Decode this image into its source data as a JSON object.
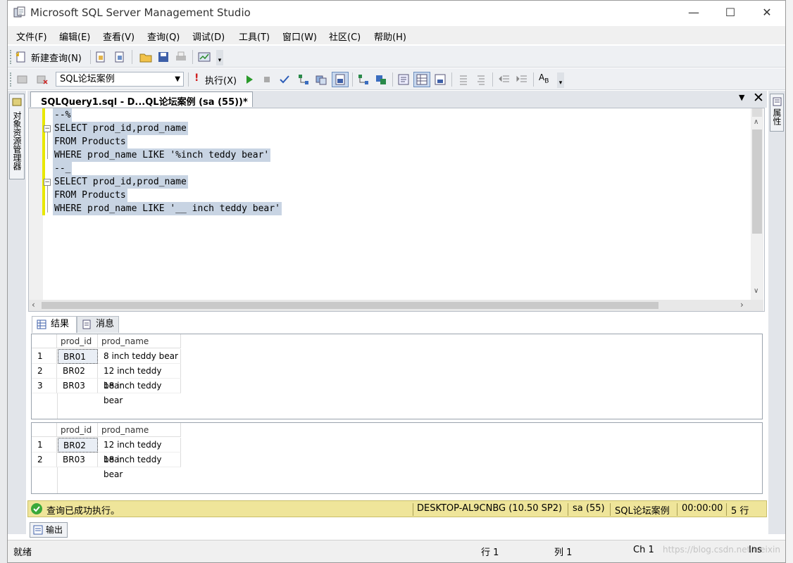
{
  "window": {
    "title": "Microsoft SQL Server Management Studio",
    "controls": [
      "—",
      "☐",
      "✕"
    ]
  },
  "menu": [
    "文件(F)",
    "编辑(E)",
    "查看(V)",
    "查询(Q)",
    "调试(D)",
    "工具(T)",
    "窗口(W)",
    "社区(C)",
    "帮助(H)"
  ],
  "toolbar1": {
    "new_query": "新建查询(N)"
  },
  "toolbar2": {
    "database": "SQL论坛案例",
    "execute": "执行(X)"
  },
  "left_panel": {
    "label": "对象资源管理器"
  },
  "right_panel": {
    "label": "属性"
  },
  "doc_tab": {
    "label": "SQLQuery1.sql - D...QL论坛案例 (sa (55))*"
  },
  "editor": {
    "lines": [
      "--%",
      "SELECT prod_id,prod_name",
      "FROM Products",
      "WHERE prod_name LIKE '%inch teddy bear'",
      "--_",
      "SELECT prod_id,prod_name",
      "FROM Products",
      "WHERE prod_name LIKE '__ inch teddy bear'"
    ]
  },
  "result_tabs": [
    {
      "label": "结果",
      "icon": "grid-icon"
    },
    {
      "label": "消息",
      "icon": "message-icon"
    }
  ],
  "results": [
    {
      "columns": [
        "prod_id",
        "prod_name"
      ],
      "rows": [
        [
          "1",
          "BR01",
          "8 inch teddy bear"
        ],
        [
          "2",
          "BR02",
          "12 inch teddy bear"
        ],
        [
          "3",
          "BR03",
          "18 inch teddy bear"
        ]
      ]
    },
    {
      "columns": [
        "prod_id",
        "prod_name"
      ],
      "rows": [
        [
          "1",
          "BR02",
          "12 inch teddy bear"
        ],
        [
          "2",
          "BR03",
          "18 inch teddy bear"
        ]
      ]
    }
  ],
  "status": {
    "message": "查询已成功执行。",
    "server": "DESKTOP-AL9CNBG (10.50 SP2)",
    "user": "sa (55)",
    "database": "SQL论坛案例",
    "time": "00:00:00",
    "rows": "5 行"
  },
  "output_tab": {
    "label": "输出"
  },
  "bottom": {
    "ready": "就绪",
    "line": "行 1",
    "col": "列 1",
    "ch": "Ch 1",
    "watermark": "https://blog.csdn.net/weixin",
    "mode": "Ins"
  },
  "colors": {
    "status_bg": "#efe59a",
    "selection": "#c8d4e3",
    "change_mark": "#e8e700"
  }
}
